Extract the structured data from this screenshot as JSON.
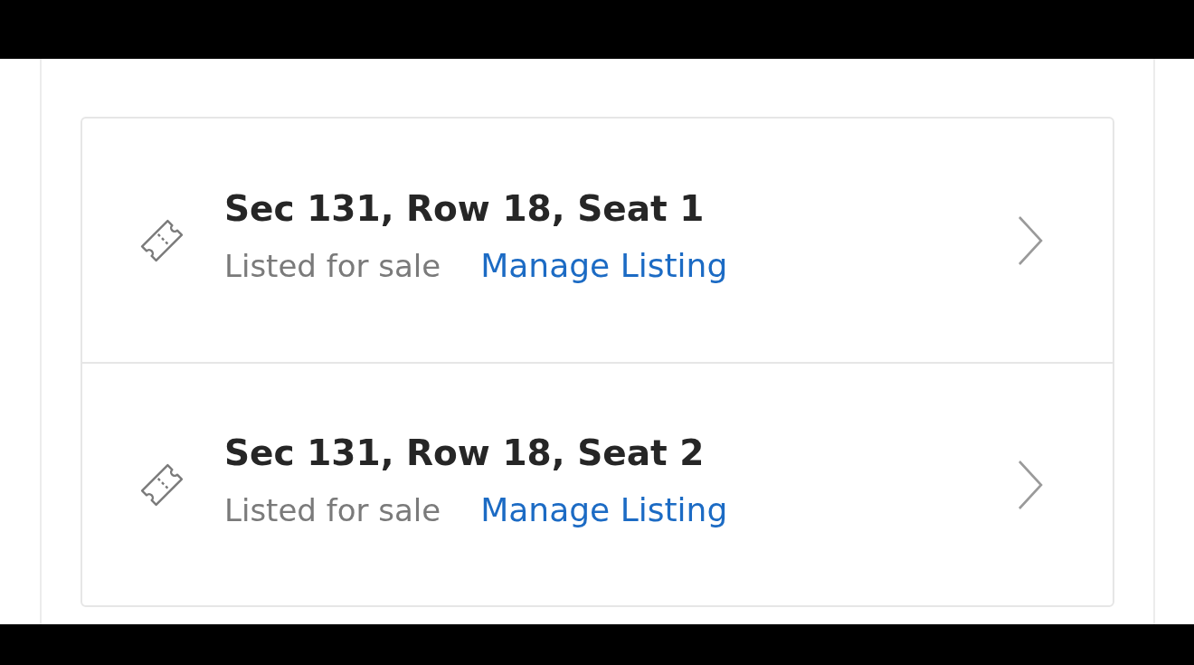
{
  "tickets": [
    {
      "title": "Sec 131, Row 18, Seat 1",
      "status": "Listed for sale",
      "action": "Manage Listing"
    },
    {
      "title": "Sec 131, Row 18, Seat 2",
      "status": "Listed for sale",
      "action": "Manage Listing"
    }
  ]
}
